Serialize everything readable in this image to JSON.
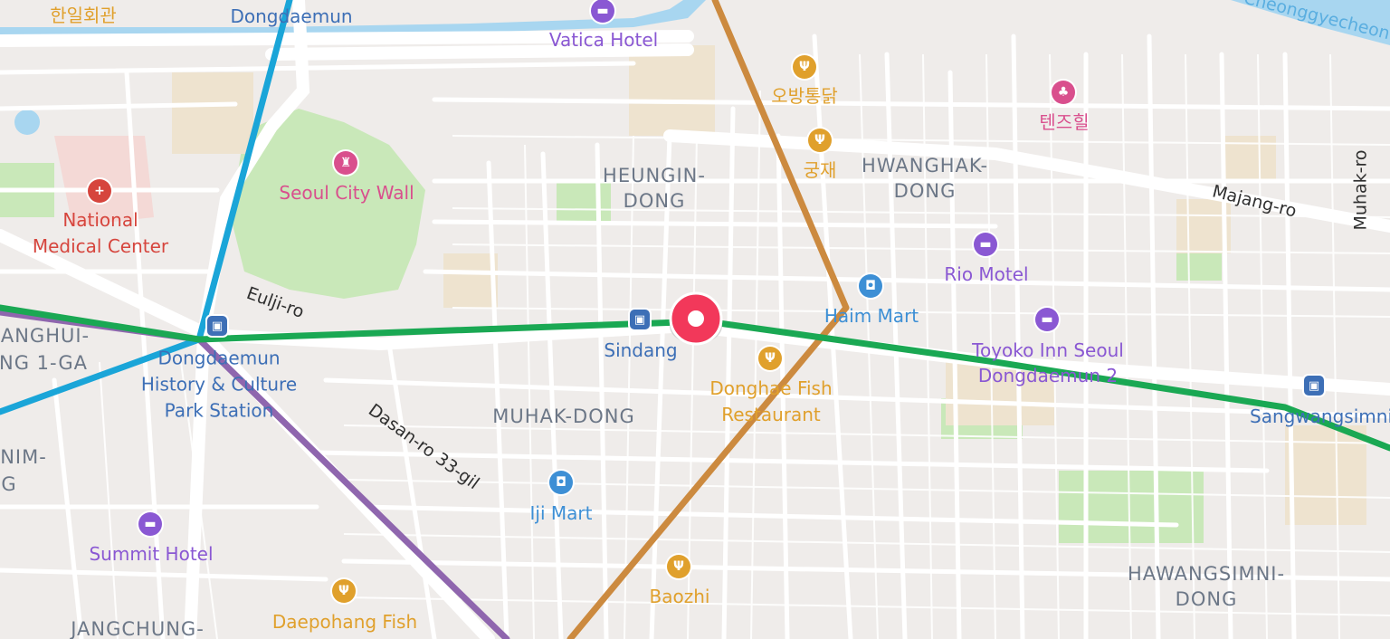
{
  "map": {
    "colors": {
      "background": "#efecea",
      "road": "#ffffff",
      "park": "#c9e8b9",
      "water": "#a8d6f0",
      "line_green": "#1aa853",
      "line_blue": "#1aa5d8",
      "line_purple": "#8f66ae",
      "line_orange": "#cc8a3f",
      "marker": "#f2385a"
    },
    "districts": {
      "heungin": [
        "HEUNGIN-",
        "DONG"
      ],
      "hwanghak": [
        "HWANGHAK-",
        "DONG"
      ],
      "muhak": "MUHAK-DONG",
      "hawangsimni": [
        "HAWANGSIMNI-",
        "DONG"
      ],
      "jangchung": "JANGCHUNG-",
      "sindangsip": "NIM-",
      "sindangsip2": "G",
      "gwanghui": "ANGHUI-",
      "gwanghui2": "NG 1-GA"
    },
    "streets": {
      "eulji": "Eulji-ro",
      "dasan": "Dasan-ro 33-gil",
      "majang": "Majang-ro",
      "muhak_ro": "Muhak-ro"
    },
    "water": {
      "cheonggyecheon": "Cheonggyecheon"
    },
    "pois": {
      "hangil": "한일회관",
      "dongdaemun_top": "Dongdaemun",
      "vatica": "Vatica Hotel",
      "obang": "오방통닭",
      "gungjae": "궁재",
      "tenjuhill": "텐즈힐",
      "seoul_city_wall": "Seoul City Wall",
      "national_medical": [
        "National",
        "Medical Center"
      ],
      "rio_motel": "Rio Motel",
      "haim_mart": "Haim Mart",
      "toyoko": [
        "Toyoko Inn Seoul",
        "Dongdaemun 2"
      ],
      "sindang": "Sindang",
      "ddp_station": [
        "Dongdaemun",
        "History & Culture",
        "Park Station"
      ],
      "donghae": [
        "Donghae Fish",
        "Restaurant"
      ],
      "sangwangsimni": "Sangwangsimni",
      "iji_mart": "Iji Mart",
      "summit": "Summit Hotel",
      "baozhi": "Baozhi",
      "daepohang": "Daepohang Fish"
    },
    "icons": {
      "food": "fork-knife-icon",
      "lodging": "bed-icon",
      "shop": "cart-icon",
      "hospital": "cross-icon",
      "park": "tree-icon",
      "transit": "train-icon",
      "marker": "location-pin-icon"
    }
  }
}
